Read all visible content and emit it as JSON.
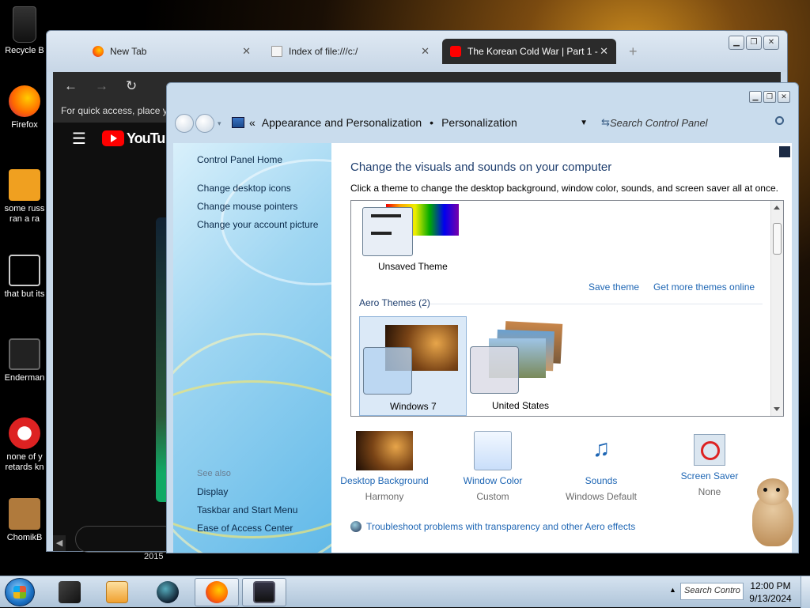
{
  "desktop": {
    "icons": [
      {
        "label": "Recycle B"
      },
      {
        "label": "Firefox"
      },
      {
        "label": "some russ ran a ra"
      },
      {
        "label": "that but its"
      },
      {
        "label": "Enderman"
      },
      {
        "label": "none of y retards kn"
      },
      {
        "label": "ChomikB"
      }
    ],
    "year_text": "2015"
  },
  "browser": {
    "tabs": [
      {
        "title": "New Tab",
        "close": "✕"
      },
      {
        "title": "Index of file:///c:/",
        "close": "✕"
      },
      {
        "title": "The Korean Cold War | Part 1 -",
        "close": "✕"
      }
    ],
    "new_tab_symbol": "+",
    "bookmarks_hint": "For quick access, place yo",
    "youtube_logo": "YouTu"
  },
  "control_panel": {
    "breadcrumb": [
      "Appearance and Personalization",
      "Personalization"
    ],
    "search_placeholder": "Search Control Panel",
    "left_links": {
      "home": "Control Panel Home",
      "desktop_icons": "Change desktop icons",
      "mouse_pointers": "Change mouse pointers",
      "account_picture": "Change your account picture"
    },
    "see_also": {
      "heading": "See also",
      "display": "Display",
      "taskbar": "Taskbar and Start Menu",
      "ease": "Ease of Access Center"
    },
    "main": {
      "title": "Change the visuals and sounds on your computer",
      "subtitle": "Click a theme to change the desktop background, window color, sounds, and screen saver all at once.",
      "unsaved_theme": "Unsaved Theme",
      "save_theme": "Save theme",
      "get_more_themes": "Get more themes online",
      "aero_heading": "Aero Themes (2)",
      "themes": [
        {
          "name": "Windows 7"
        },
        {
          "name": "United States"
        }
      ],
      "bottom": [
        {
          "label": "Desktop Background",
          "value": "Harmony"
        },
        {
          "label": "Window Color",
          "value": "Custom"
        },
        {
          "label": "Sounds",
          "value": "Windows Default"
        },
        {
          "label": "Screen Saver",
          "value": "None"
        }
      ],
      "troubleshoot": "Troubleshoot problems with transparency and other Aero effects"
    }
  },
  "taskbar": {
    "search_text": "Search Contro",
    "time": "12:00 PM",
    "date": "9/13/2024"
  }
}
